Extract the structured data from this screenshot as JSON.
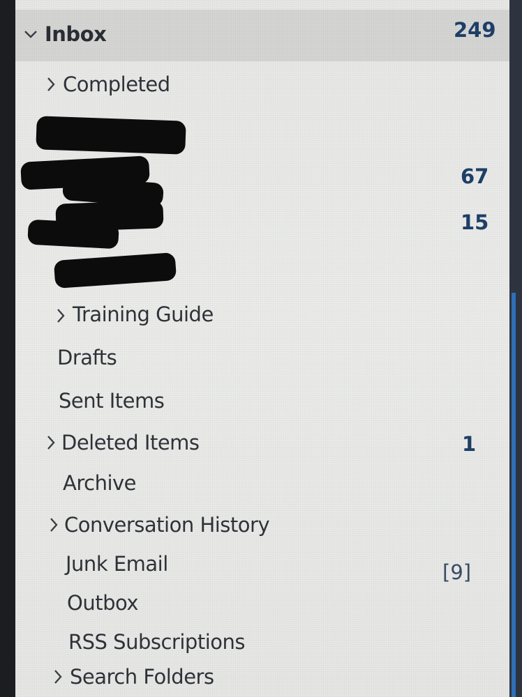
{
  "folder_pane": {
    "folders": [
      {
        "id": "inbox",
        "label": "Inbox",
        "count": "249",
        "expanded": true,
        "selected": true
      },
      {
        "id": "completed",
        "label": "Completed",
        "collapsible": true
      },
      {
        "id": "redacted-1",
        "redacted": true
      },
      {
        "id": "redacted-2",
        "redacted": true,
        "count": "67"
      },
      {
        "id": "redacted-3",
        "redacted": true,
        "count": "15"
      },
      {
        "id": "redacted-4",
        "redacted": true
      },
      {
        "id": "training-guide",
        "label": "Training Guide",
        "collapsible": true
      },
      {
        "id": "drafts",
        "label": "Drafts"
      },
      {
        "id": "sent-items",
        "label": "Sent Items"
      },
      {
        "id": "deleted-items",
        "label": "Deleted Items",
        "count": "1",
        "collapsible": true
      },
      {
        "id": "archive",
        "label": "Archive"
      },
      {
        "id": "conversation-history",
        "label": "Conversation History",
        "collapsible": true
      },
      {
        "id": "junk-email",
        "label": "Junk Email",
        "count": "[9]"
      },
      {
        "id": "outbox",
        "label": "Outbox"
      },
      {
        "id": "rss-subscriptions",
        "label": "RSS Subscriptions"
      },
      {
        "id": "search-folders",
        "label": "Search Folders",
        "collapsible": true
      }
    ]
  },
  "colors": {
    "pane_background": "#e9eae8",
    "selected_row": "#d5d6d4",
    "unread_count": "#1f3f68",
    "scroll_accent": "#2f6fb8"
  },
  "icons": {
    "expanded": "chevron-down-icon",
    "collapsed": "chevron-right-icon"
  }
}
